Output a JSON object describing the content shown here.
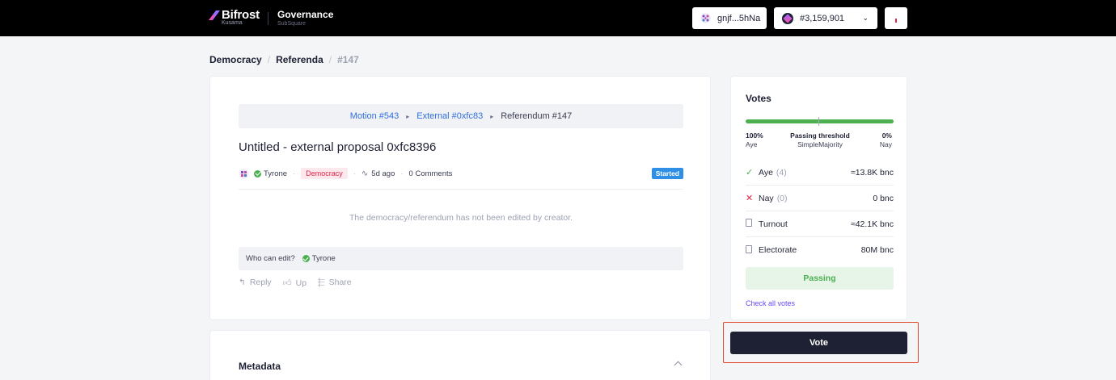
{
  "header": {
    "logo_name": "Bifrost",
    "logo_sub": "Kusama",
    "app_title": "Governance",
    "app_sub": "SubSquare",
    "account": "gnjf...5hNa",
    "block": "#3,159,901"
  },
  "breadcrumb": [
    "Democracy",
    "/",
    "Referenda",
    "/",
    "#147"
  ],
  "relations": {
    "motion": "Motion #543",
    "external": "External #0xfc83",
    "referendum": "Referendum #147"
  },
  "post": {
    "title": "Untitled - external proposal 0xfc8396",
    "author": "Tyrone",
    "category": "Democracy",
    "time": "5d ago",
    "comments": "0 Comments",
    "status": "Started",
    "no_edit_text": "The democracy/referendum has not been edited by creator.",
    "who_can_edit_label": "Who can edit?",
    "editor": "Tyrone",
    "actions": {
      "reply": "Reply",
      "up": "Up",
      "share": "Share"
    }
  },
  "metadata": {
    "title": "Metadata"
  },
  "votes": {
    "title": "Votes",
    "aye_percent": "100%",
    "aye_label": "Aye",
    "threshold_label": "Passing threshold",
    "threshold_type": "SimpleMajority",
    "nay_percent": "0%",
    "nay_label": "Nay",
    "aye_fraction": 1.0,
    "rows": [
      {
        "name": "Aye",
        "count": "(4)",
        "value": "≈13.8K bnc"
      },
      {
        "name": "Nay",
        "count": "(0)",
        "value": "0 bnc"
      },
      {
        "name": "Turnout",
        "count": "",
        "value": "≈42.1K bnc"
      },
      {
        "name": "Electorate",
        "count": "",
        "value": "80M bnc"
      }
    ],
    "status": "Passing",
    "check_all": "Check all votes"
  },
  "vote_button": "Vote",
  "colors": {
    "aye": "#4caf50",
    "nay": "#e5264a",
    "link": "#2f6fde",
    "accent": "#6848ff",
    "primary": "#1e2134"
  }
}
